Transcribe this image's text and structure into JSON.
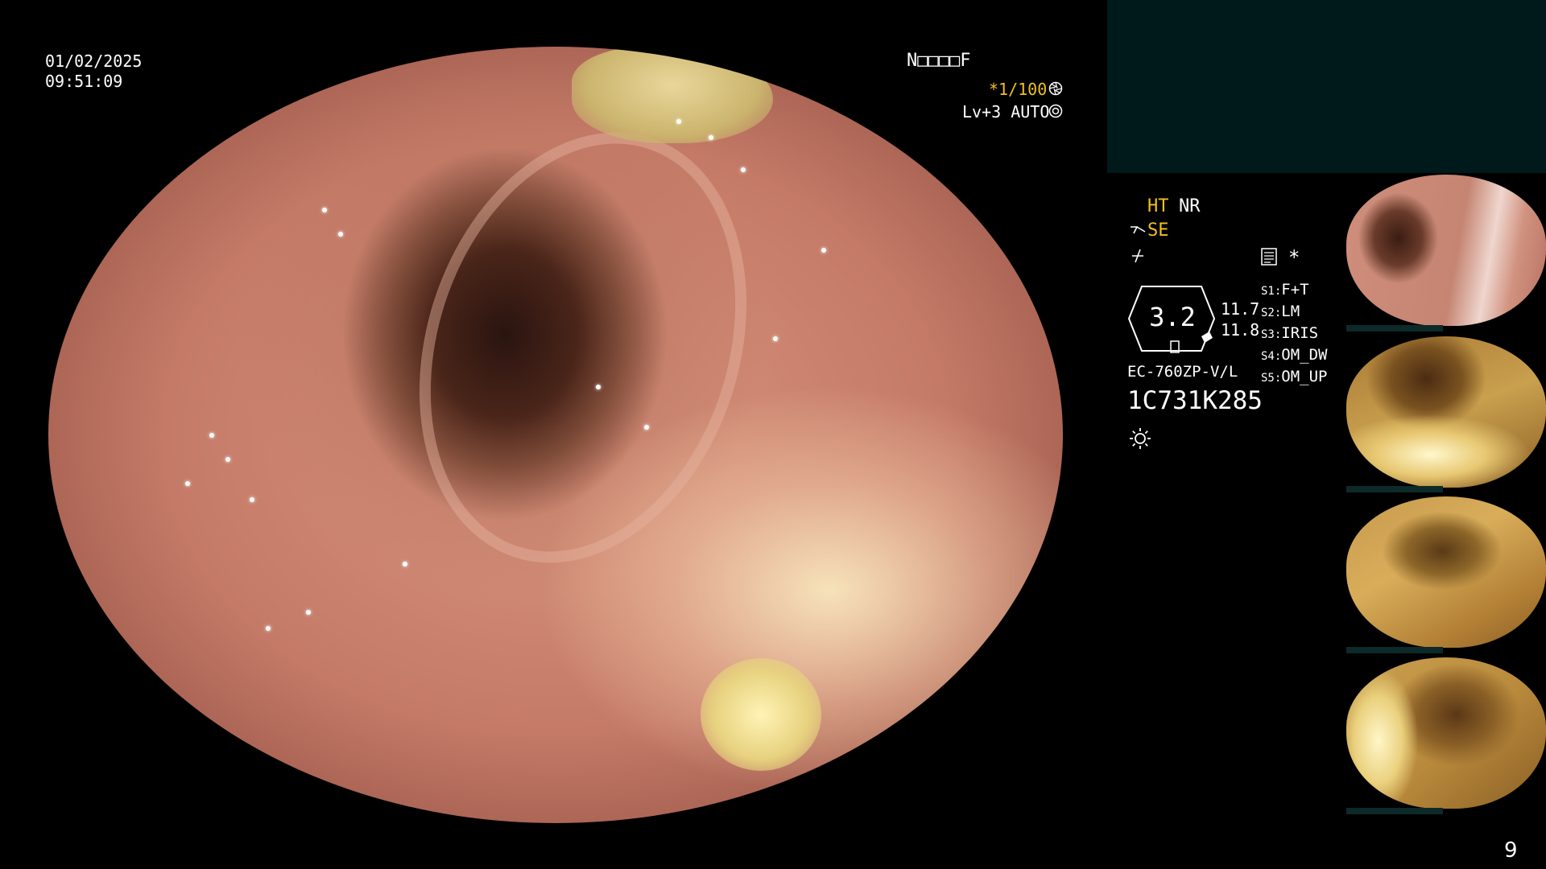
{
  "overlay": {
    "date": "01/02/2025",
    "time": "09:51:09",
    "name_field": "N□□□□F",
    "shutter": "*1/100",
    "shutter_icon": "aperture-icon",
    "level_mode": "Lv+3 AUTO",
    "level_icon": "iris-icon"
  },
  "panel": {
    "ht": "HT",
    "nr": "NR",
    "se": "SE",
    "se_icon": "structure-enhance-icon",
    "color_icon": "color-mode-icon",
    "memo_icon": "memo-icon",
    "asterisk": "*",
    "gauge_value": "3.2",
    "readout_top": "11.7",
    "readout_bottom": "11.8",
    "switches": [
      {
        "key": "S1:",
        "value": "F+T"
      },
      {
        "key": "S2:",
        "value": "LM"
      },
      {
        "key": "S3:",
        "value": "IRIS"
      },
      {
        "key": "S4:",
        "value": "OM_DW"
      },
      {
        "key": "S5:",
        "value": "OM_UP"
      }
    ],
    "model": "EC-760ZP-V/L",
    "serial": "1C731K285",
    "light_icon": "light-icon"
  },
  "page_number": "9",
  "colors": {
    "accent_yellow": "#f0c020",
    "panel_teal": "#00191a"
  }
}
